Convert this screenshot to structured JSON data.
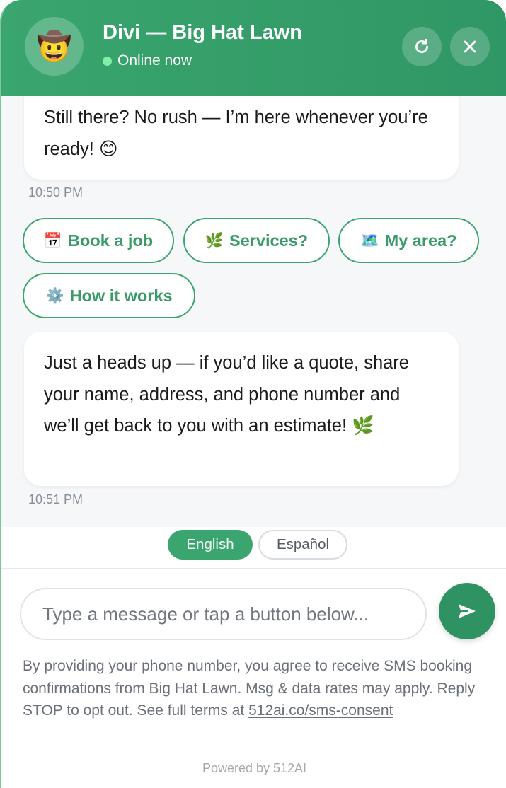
{
  "header": {
    "avatar_emoji": "🤠",
    "bot_name": "Divi — Big Hat Lawn",
    "status": "Online now",
    "status_color": "#7ff0a6",
    "brand_color": "#3aa56e",
    "refresh_icon": "refresh-icon",
    "close_icon": "close-icon"
  },
  "messages": [
    {
      "text": "Still there? No rush — I’m here whenever you’re ready! 😊",
      "time": "10:50 PM"
    },
    {
      "text": "Just a heads up — if you’d like a quote, share your name, address, and phone number and we’ll get back to you with an estimate! 🌿",
      "time": "10:51 PM"
    }
  ],
  "quick_replies": [
    {
      "emoji": "📅",
      "label": "Book a job"
    },
    {
      "emoji": "🌿",
      "label": "Services?"
    },
    {
      "emoji": "🗺️",
      "label": "My area?"
    },
    {
      "emoji": "⚙️",
      "label": "How it works"
    }
  ],
  "language": {
    "options": [
      "English",
      "Español"
    ],
    "selected": "English"
  },
  "composer": {
    "placeholder": "Type a message or tap a button below...",
    "value": "",
    "send_icon": "send-icon"
  },
  "consent": {
    "text": "By providing your phone number, you agree to receive SMS booking confirmations from Big Hat Lawn. Msg & data rates may apply. Reply STOP to opt out. See full terms at",
    "link": "512ai.co/sms-consent"
  },
  "footer": {
    "powered_by": "Powered by 512AI"
  }
}
